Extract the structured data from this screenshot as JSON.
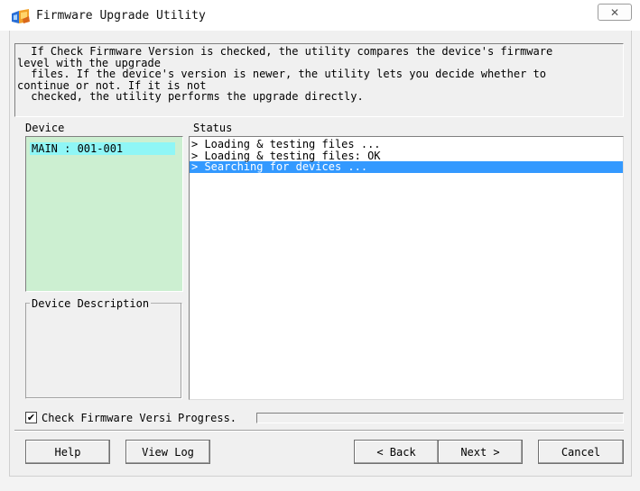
{
  "window": {
    "title": "Firmware Upgrade Utility",
    "close_glyph": "✕"
  },
  "info": {
    "lines": [
      " If Check Firmware Version is checked, the utility compares the device's firmware",
      "level with the upgrade",
      " files. If the device's version is newer, the utility lets you decide whether to",
      "continue or not. If it is not",
      " checked, the utility performs the upgrade directly."
    ]
  },
  "device_panel": {
    "label": "Device",
    "items": [
      "MAIN : 001-001"
    ],
    "background": "#ccefd1",
    "selected_color": "#8ff6f6"
  },
  "description": {
    "label": "Device Description"
  },
  "status_panel": {
    "label": "Status",
    "rows": [
      "> Loading & testing files ...",
      "> Loading & testing files: OK",
      "> Searching for devices ..."
    ],
    "selected_index": 2,
    "selection_color": "#3399ff"
  },
  "options": {
    "check_firmware_label": "Check Firmware Versi",
    "check_firmware_checked": true,
    "progress_label": "Progress.",
    "progress_value": 0
  },
  "buttons": {
    "help": "Help",
    "view_log": "View Log",
    "back": "< Back",
    "next": "Next >",
    "cancel": "Cancel"
  }
}
